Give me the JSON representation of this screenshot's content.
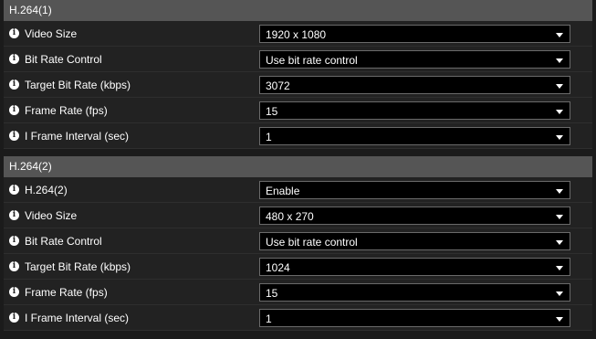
{
  "sections": [
    {
      "title": "H.264(1)",
      "rows": [
        {
          "label": "Video Size",
          "value": "1920 x 1080"
        },
        {
          "label": "Bit Rate Control",
          "value": "Use bit rate control"
        },
        {
          "label": "Target Bit Rate (kbps)",
          "value": "3072"
        },
        {
          "label": "Frame Rate (fps)",
          "value": "15"
        },
        {
          "label": "I Frame Interval (sec)",
          "value": "1"
        }
      ]
    },
    {
      "title": "H.264(2)",
      "rows": [
        {
          "label": "H.264(2)",
          "value": "Enable"
        },
        {
          "label": "Video Size",
          "value": "480 x 270"
        },
        {
          "label": "Bit Rate Control",
          "value": "Use bit rate control"
        },
        {
          "label": "Target Bit Rate (kbps)",
          "value": "1024"
        },
        {
          "label": "Frame Rate (fps)",
          "value": "15"
        },
        {
          "label": "I Frame Interval (sec)",
          "value": "1"
        }
      ]
    }
  ]
}
